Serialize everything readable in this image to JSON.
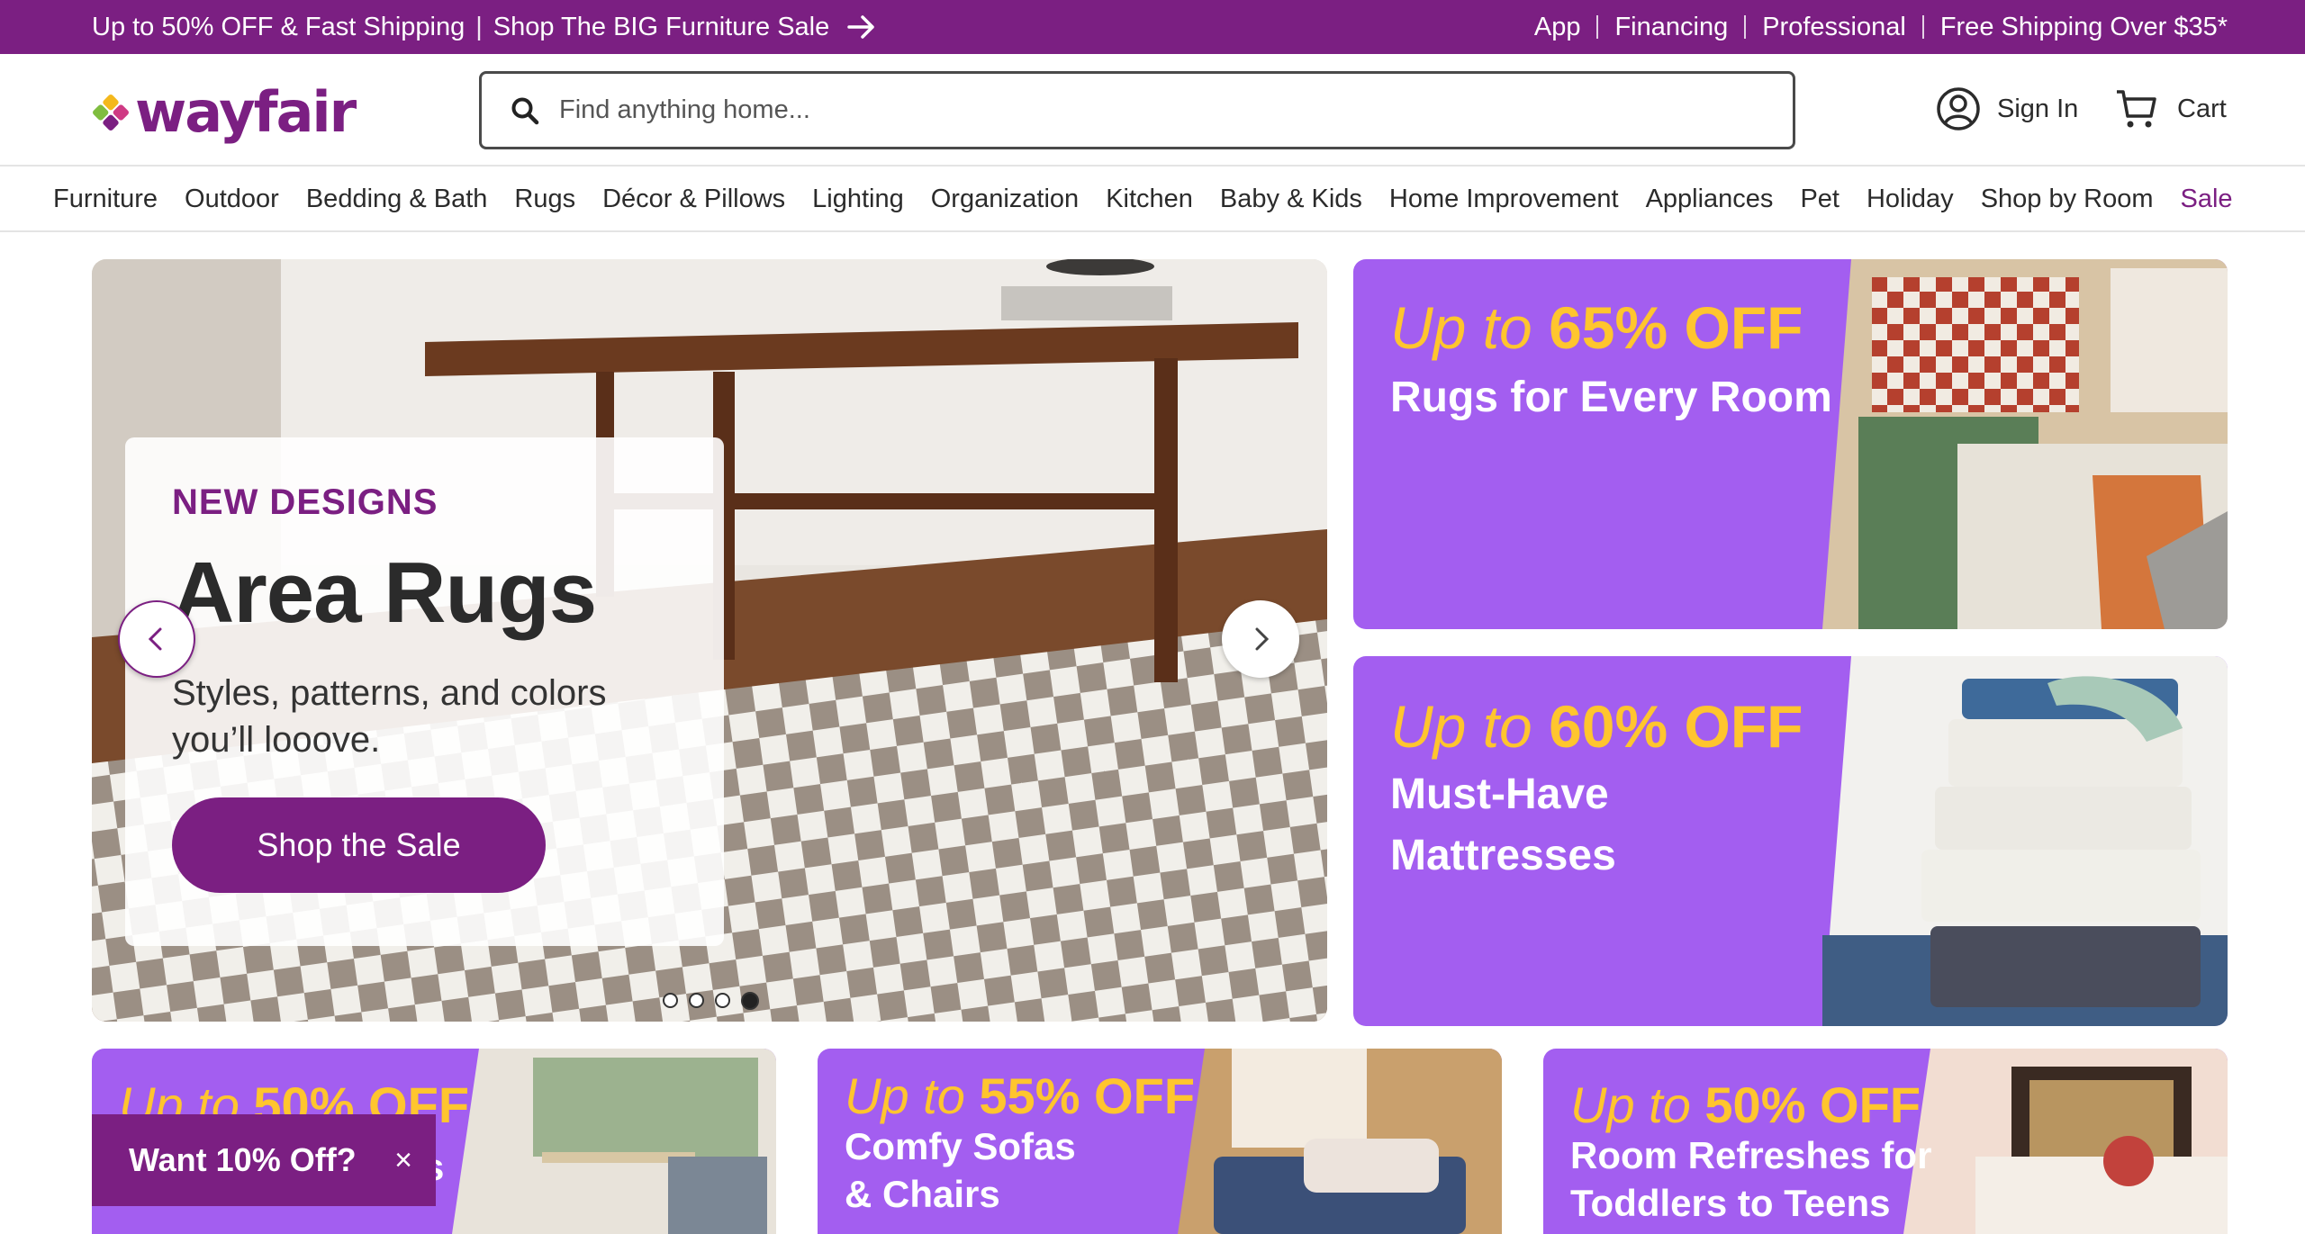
{
  "promo": {
    "left_text": "Up to 50% OFF & Fast Shipping",
    "separator": "|",
    "left_link": "Shop The BIG Furniture Sale",
    "links": [
      "App",
      "Financing",
      "Professional",
      "Free Shipping Over $35*"
    ]
  },
  "header": {
    "logo_text": "wayfair",
    "search_placeholder": "Find anything home...",
    "sign_in": "Sign In",
    "cart": "Cart"
  },
  "nav": {
    "items": [
      "Furniture",
      "Outdoor",
      "Bedding & Bath",
      "Rugs",
      "Décor & Pillows",
      "Lighting",
      "Organization",
      "Kitchen",
      "Baby & Kids",
      "Home Improvement",
      "Appliances",
      "Pet",
      "Holiday",
      "Shop by Room",
      "Sale"
    ]
  },
  "hero": {
    "eyebrow": "NEW DESIGNS",
    "title": "Area Rugs",
    "subtitle": "Styles, patterns, and colors you’ll looove.",
    "cta": "Shop the Sale",
    "slide_count": 4,
    "active_slide": 4
  },
  "tiles": [
    {
      "prefix": "Up to ",
      "amount": "65% OFF",
      "desc": "Rugs for Every Room"
    },
    {
      "prefix": "Up to ",
      "amount": "60% OFF",
      "desc_line1": "Must-Have",
      "desc_line2": "Mattresses"
    }
  ],
  "bottom_tiles": [
    {
      "prefix": "Up to ",
      "amount": "50% OFF",
      "desc_partial": "s"
    },
    {
      "prefix": "Up to ",
      "amount": "55% OFF",
      "desc_line1": "Comfy Sofas",
      "desc_line2": "& Chairs"
    },
    {
      "prefix": "Up to ",
      "amount": "50% OFF",
      "desc_line1": "Room Refreshes for",
      "desc_line2": "Toddlers to Teens"
    }
  ],
  "offer": {
    "label": "Want 10% Off?",
    "close": "×"
  },
  "colors": {
    "brand": "#7b1f82",
    "tile_purple": "#a35ef0",
    "tile_yellow": "#ffc52e"
  }
}
